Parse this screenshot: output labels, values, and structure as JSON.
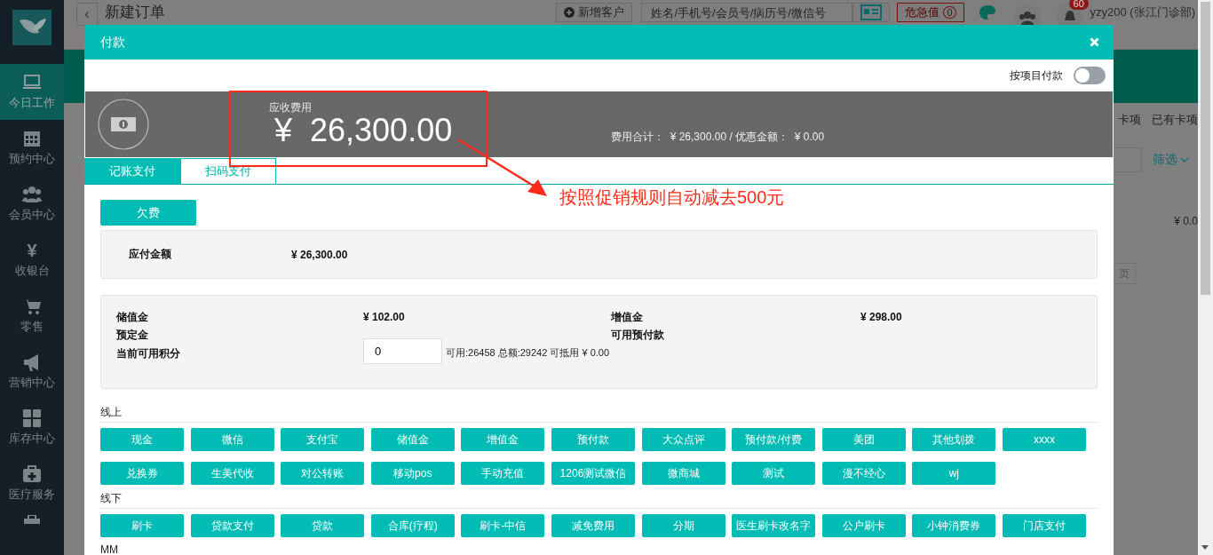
{
  "app": {
    "sidebar": {
      "items": [
        {
          "label": "今日工作",
          "kind": "monitor",
          "selected": true
        },
        {
          "label": "预约中心",
          "kind": "calendar",
          "selected": false
        },
        {
          "label": "会员中心",
          "kind": "users",
          "selected": false
        },
        {
          "label": "收银台",
          "kind": "glyph",
          "glyph": "¥",
          "selected": false
        },
        {
          "label": "零售",
          "kind": "cart",
          "selected": false
        },
        {
          "label": "营销中心",
          "kind": "megaphone",
          "selected": false
        },
        {
          "label": "库存中心",
          "kind": "grid",
          "selected": false
        },
        {
          "label": "医疗服务",
          "kind": "medkit",
          "selected": false
        }
      ]
    },
    "header": {
      "back": "‹",
      "title": "新建订单",
      "add_customer": "新增客户",
      "search_placeholder": "姓名/手机号/会员号/病历号/微信号",
      "critical": "危急值",
      "critical_count": "0",
      "badge": "60",
      "user": "yzy200 (张江门诊部)"
    },
    "side_panel": {
      "tabs": [
        "卡项",
        "已有卡项"
      ],
      "filter": "筛选",
      "amount": "¥ 0.0",
      "page": "页"
    }
  },
  "dialog": {
    "title": "付款",
    "toggle": {
      "label": "按项目付款",
      "on": false
    },
    "summary": {
      "label": "应收费用",
      "amount": "¥  26,300.00",
      "totals": "费用合计：  ¥ 26,300.00 / 优惠金额：  ¥ 0.00"
    },
    "tabs": [
      {
        "label": "记账支付",
        "selected": true
      },
      {
        "label": "扫码支付",
        "selected": false
      }
    ],
    "arrears_button": "欠费",
    "payable": {
      "label": "应付金额",
      "value": "¥ 26,300.00"
    },
    "balances": [
      {
        "label": "储值金",
        "value": "¥ 102.00"
      },
      {
        "label": "增值金",
        "value": "¥ 298.00"
      },
      {
        "label": "预定金"
      },
      {
        "label": "可用预付款"
      }
    ],
    "points": {
      "label": "当前可用积分",
      "value": "0",
      "info": "可用:26458 总额:29242 可抵用 ¥ 0.00"
    },
    "groups": [
      {
        "name": "线上",
        "methods": [
          "现金",
          "微信",
          "支付宝",
          "储值金",
          "增值金",
          "预付款",
          "大众点评",
          "预付款/付费",
          "美团",
          "其他划拨",
          "xxxx",
          "兑换券",
          "生美代收",
          "对公转账",
          "移动pos",
          "手动充值",
          "1206测试微信",
          "微商城",
          "测试",
          "漫不经心",
          "wj"
        ]
      },
      {
        "name": "线下",
        "methods": [
          "刷卡",
          "贷款支付",
          "贷款",
          "合库(疗程)",
          "刷卡-中信",
          "减免费用",
          "分期",
          "医生刷卡改名字",
          "公户刷卡",
          "小钟消费券",
          "门店支付"
        ]
      },
      {
        "name": "MM"
      }
    ]
  },
  "annotation": {
    "text": "按照促销规则自动减去500元"
  }
}
